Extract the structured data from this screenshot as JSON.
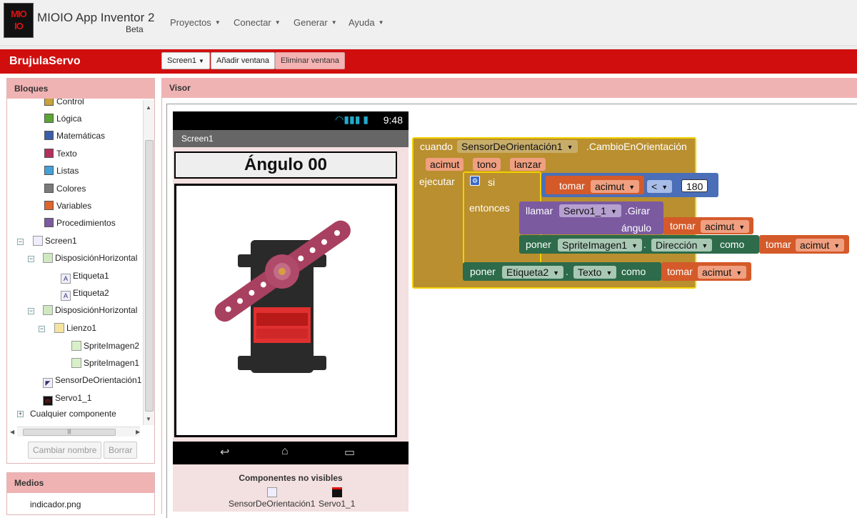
{
  "app": {
    "logo_top": "MIO",
    "logo_bottom": "IO",
    "title": "MIOIO App Inventor 2",
    "beta": "Beta"
  },
  "menu": [
    {
      "label": "Proyectos"
    },
    {
      "label": "Conectar"
    },
    {
      "label": "Generar"
    },
    {
      "label": "Ayuda"
    }
  ],
  "project": {
    "name": "BrujulaServo",
    "screen_select": "Screen1",
    "add_screen": "Añadir ventana",
    "remove_screen": "Eliminar ventana"
  },
  "blocks_panel": {
    "title": "Bloques",
    "builtins": [
      {
        "label": "Control",
        "color": "#c8a23a"
      },
      {
        "label": "Lógica",
        "color": "#5ba534"
      },
      {
        "label": "Matemáticas",
        "color": "#3b5ea8"
      },
      {
        "label": "Texto",
        "color": "#b3305a"
      },
      {
        "label": "Listas",
        "color": "#44a0d8"
      },
      {
        "label": "Colores",
        "color": "#7a7a7a"
      },
      {
        "label": "Variables",
        "color": "#e0642e"
      },
      {
        "label": "Procedimientos",
        "color": "#7b5aa0"
      }
    ],
    "components": {
      "screen": "Screen1",
      "hz1": "DisposiciónHorizontal",
      "etiqueta1": "Etiqueta1",
      "etiqueta2": "Etiqueta2",
      "hz2": "DisposiciónHorizontal",
      "lienzo": "Lienzo1",
      "sprite2": "SpriteImagen2",
      "sprite1": "SpriteImagen1",
      "sensor": "SensorDeOrientación1",
      "servo": "Servo1_1",
      "any": "Cualquier componente"
    },
    "rename_button": "Cambiar nombre",
    "delete_button": "Borrar"
  },
  "media": {
    "title": "Medios",
    "file": "indicador.png"
  },
  "viewer": {
    "title": "Visor",
    "phone": {
      "time": "9:48",
      "screen_title": "Screen1",
      "angle_label": "Ángulo  00",
      "nonvisible_title": "Componentes no visibles",
      "nonvisible": [
        "SensorDeOrientación1",
        "Servo1_1"
      ]
    }
  },
  "blocks": {
    "when": "cuando",
    "event_component": "SensorDeOrientación1",
    "event_name": ".CambioEnOrientación",
    "params": [
      "acimut",
      "tono",
      "lanzar"
    ],
    "do": "ejecutar",
    "if": "si",
    "then": "entonces",
    "get": "tomar",
    "var": "acimut",
    "op": "<",
    "number": "180",
    "call": "llamar",
    "servo": "Servo1_1",
    "method": ".Girar",
    "angle_arg": "ángulo",
    "set": "poner",
    "sprite": "SpriteImagen1",
    "dot": ".",
    "prop_dir": "Dirección",
    "to": "como",
    "label": "Etiqueta2",
    "prop_text": "Texto",
    "colors": {
      "event": "#b98f2f",
      "control": "#b98f2f",
      "logic": "#4a6fb8",
      "var": "#d45a2a",
      "proc": "#7b5aa0",
      "comp": "#2d6b4a"
    }
  }
}
